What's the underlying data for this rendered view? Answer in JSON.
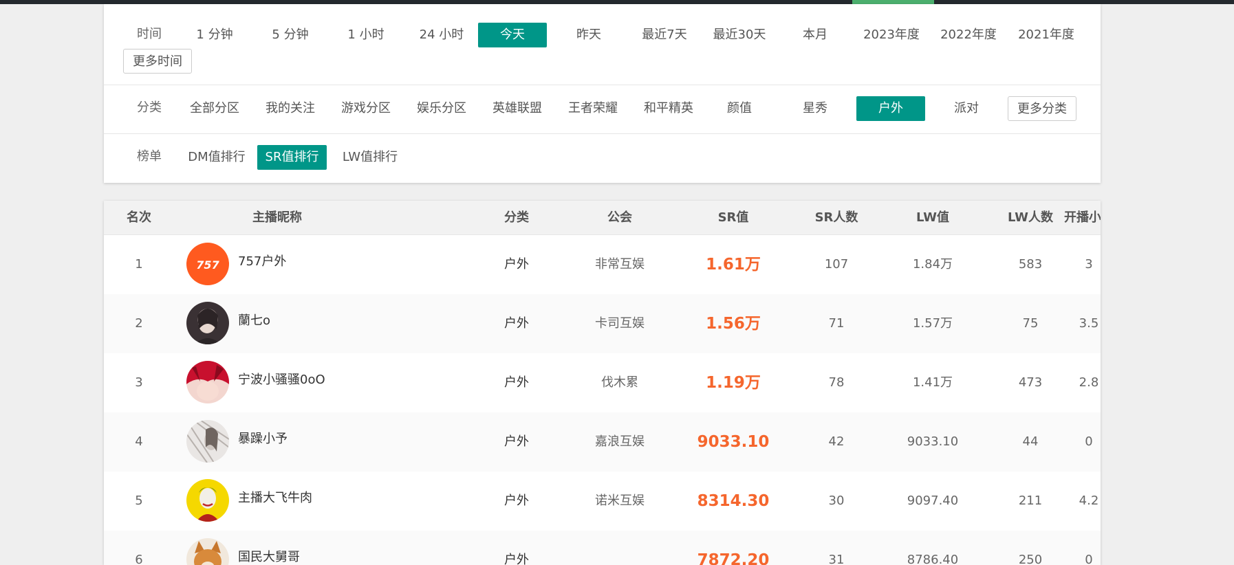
{
  "filters": {
    "time": {
      "label": "时间",
      "options": [
        "1 分钟",
        "5 分钟",
        "1 小时",
        "24 小时",
        "今天",
        "昨天",
        "最近7天",
        "最近30天",
        "本月",
        "2023年度",
        "2022年度",
        "2021年度"
      ],
      "active": "今天",
      "more": "更多时间"
    },
    "category": {
      "label": "分类",
      "options": [
        "全部分区",
        "我的关注",
        "游戏分区",
        "娱乐分区",
        "英雄联盟",
        "王者荣耀",
        "和平精英",
        "颜值",
        "星秀",
        "户外",
        "派对"
      ],
      "active": "户外",
      "more": "更多分类"
    },
    "ranking": {
      "label": "榜单",
      "options": [
        "DM值排行",
        "SR值排行",
        "LW值排行"
      ],
      "active": "SR值排行"
    }
  },
  "table": {
    "columns": [
      "名次",
      "主播昵称",
      "分类",
      "公会",
      "SR值",
      "SR人数",
      "LW值",
      "LW人数",
      "开播小时"
    ],
    "rows": [
      {
        "rank": "1",
        "name": "757户外",
        "avatar_label": "757",
        "avatar": "orange-logo",
        "category": "户外",
        "guild": "非常互娱",
        "sr": "1.61万",
        "sr_count": "107",
        "lw": "1.84万",
        "lw_count": "583",
        "hours": "3"
      },
      {
        "rank": "2",
        "name": "蘭七o",
        "avatar": "girl-photo",
        "category": "户外",
        "guild": "卡司互娱",
        "sr": "1.56万",
        "sr_count": "71",
        "lw": "1.57万",
        "lw_count": "75",
        "hours": "3.5"
      },
      {
        "rank": "3",
        "name": "宁波小骚骚0oO",
        "avatar": "anime-red-hair",
        "category": "户外",
        "guild": "伐木累",
        "sr": "1.19万",
        "sr_count": "78",
        "lw": "1.41万",
        "lw_count": "473",
        "hours": "2.8"
      },
      {
        "rank": "4",
        "name": "暴躁小予",
        "avatar": "sketch-girl",
        "category": "户外",
        "guild": "嘉浪互娱",
        "sr": "9033.10",
        "sr_count": "42",
        "lw": "9033.10",
        "lw_count": "44",
        "hours": "0"
      },
      {
        "rank": "5",
        "name": "主播大飞牛肉",
        "avatar": "joker-yellow",
        "category": "户外",
        "guild": "诺米互娱",
        "sr": "8314.30",
        "sr_count": "30",
        "lw": "9097.40",
        "lw_count": "211",
        "hours": "4.2"
      },
      {
        "rank": "6",
        "name": "国民大舅哥",
        "avatar": "shiba-dog",
        "category": "户外",
        "guild": "",
        "sr": "7872.20",
        "sr_count": "31",
        "lw": "8786.40",
        "lw_count": "250",
        "hours": "0"
      }
    ]
  },
  "colors": {
    "accent": "#009688",
    "sr_value": "#f5662d",
    "topbar": "#24292e",
    "topbar_accent": "#4caf6e"
  }
}
